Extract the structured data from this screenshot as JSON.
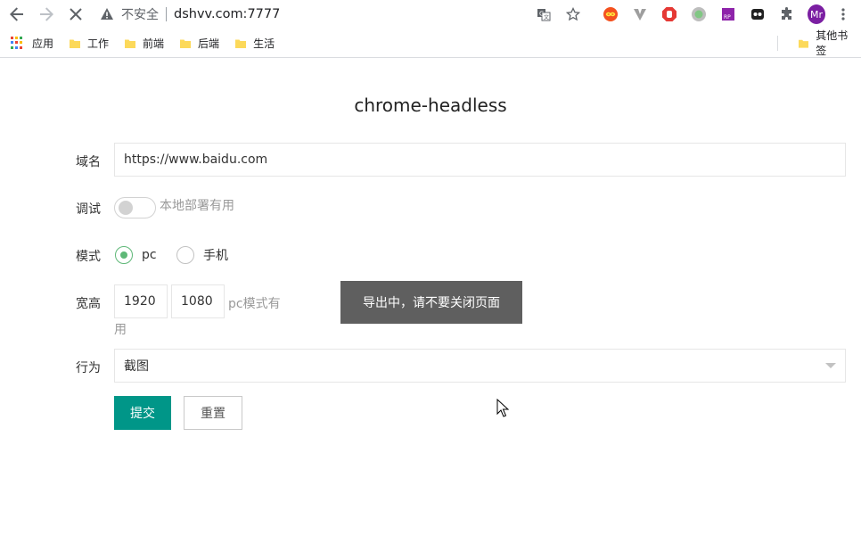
{
  "browser": {
    "security_text": "不安全",
    "url": "dshvv.com:7777",
    "profile_initials": "Mr",
    "icons": [
      "back-arrow-icon",
      "forward-arrow-icon",
      "stop-loading-icon",
      "warning-icon",
      "translate-icon",
      "star-bookmark-icon",
      "extension-infinity-icon",
      "extension-v-icon",
      "extension-stop-icon",
      "extension-circle-icon",
      "extension-rp-icon",
      "extension-dark-icon",
      "extensions-puzzle-icon",
      "menu-kebab-icon"
    ]
  },
  "bookmarks": {
    "apps_label": "应用",
    "items": [
      "工作",
      "前端",
      "后端",
      "生活"
    ],
    "other_label": "其他书签"
  },
  "page": {
    "title": "chrome-headless"
  },
  "form": {
    "domain_label": "域名",
    "domain_value": "https://www.baidu.com",
    "debug_label": "调试",
    "debug_hint": "本地部署有用",
    "mode_label": "模式",
    "mode_options": [
      "pc",
      "手机"
    ],
    "mode_selected": "pc",
    "size_label": "宽高",
    "width_value": "1920",
    "height_value": "1080",
    "size_hint_line1": "pc模式有",
    "size_hint_line2": "用",
    "action_label": "行为",
    "action_value": "截图",
    "submit_label": "提交",
    "reset_label": "重置"
  },
  "toast": {
    "message": "导出中，请不要关闭页面"
  },
  "colors": {
    "primary": "#009688",
    "radio_checked": "#5fb878",
    "toast_bg": "#5f5f5f",
    "avatar": "#7b1fa2"
  }
}
